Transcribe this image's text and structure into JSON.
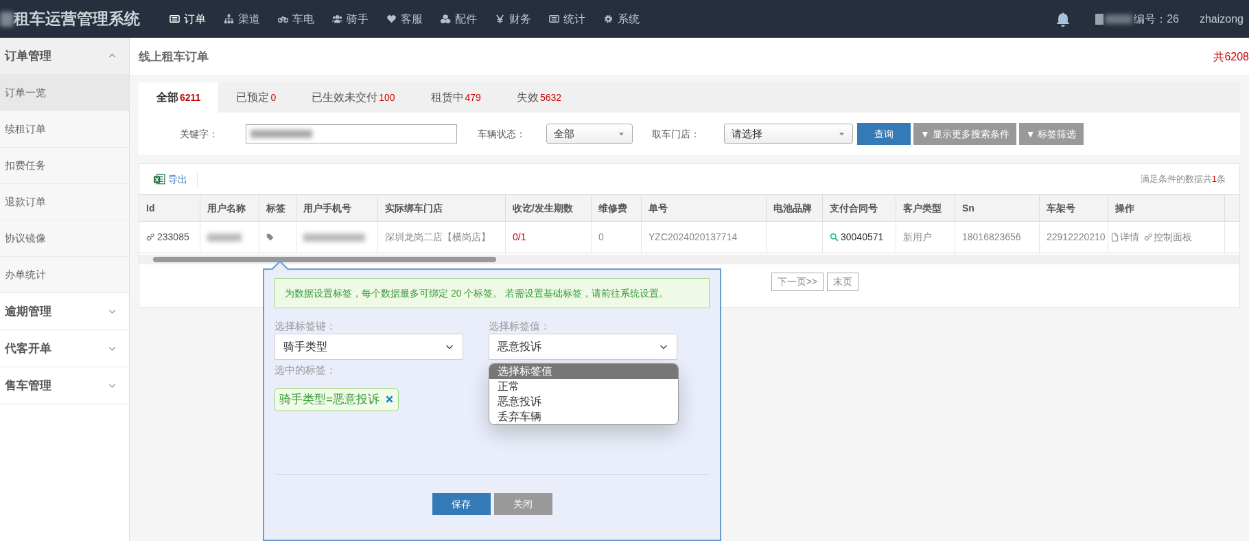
{
  "app_title": "租车运营管理系统",
  "nav": [
    {
      "label": "订单",
      "selected": true
    },
    {
      "label": "渠道",
      "selected": false
    },
    {
      "label": "车电",
      "selected": false
    },
    {
      "label": "骑手",
      "selected": false
    },
    {
      "label": "客服",
      "selected": false
    },
    {
      "label": "配件",
      "selected": false
    },
    {
      "label": "财务",
      "selected": false
    },
    {
      "label": "统计",
      "selected": false
    },
    {
      "label": "系统",
      "selected": false
    }
  ],
  "user": {
    "account": "编号：26",
    "name": "zhaizong"
  },
  "sidebar": [
    {
      "label": "订单管理",
      "expanded": true,
      "children": [
        {
          "label": "订单一览",
          "selected": true
        },
        {
          "label": "续租订单",
          "selected": false
        },
        {
          "label": "扣费任务",
          "selected": false
        },
        {
          "label": "退款订单",
          "selected": false
        },
        {
          "label": "协议镜像",
          "selected": false
        },
        {
          "label": "办单统计",
          "selected": false
        }
      ]
    },
    {
      "label": "逾期管理",
      "expanded": false
    },
    {
      "label": "代客开单",
      "expanded": false
    },
    {
      "label": "售车管理",
      "expanded": false
    }
  ],
  "page_title": "线上租车订单",
  "total": "共6208",
  "tabs": [
    {
      "label": "全部",
      "count": "6211",
      "selected": true
    },
    {
      "label": "已预定",
      "count": "0",
      "selected": false
    },
    {
      "label": "已生效未交付",
      "count": "100",
      "selected": false
    },
    {
      "label": "租赁中",
      "count": "479",
      "selected": false
    },
    {
      "label": "失效",
      "count": "5632",
      "selected": false
    }
  ],
  "filters": {
    "keyword_label": "关键字：",
    "vehicle_status_label": "车辆状态：",
    "vehicle_status": "全部",
    "store_label": "取车门店：",
    "store": "请选择",
    "search_button": "查询",
    "more_button": "▼ 显示更多搜索条件",
    "tag_button": "▼ 标签筛选"
  },
  "export": "导出",
  "result_text": "满足条件的数据共**1**条",
  "table": {
    "columns": [
      "Id",
      "用户名称",
      "标签",
      "用户手机号",
      "实际绑车门店",
      "收讫/发生期数",
      "维修费",
      "单号",
      "电池品牌",
      "支付合同号",
      "客户类型",
      "Sn",
      "车架号",
      "操作"
    ],
    "rows": [
      {
        "id": "233085",
        "store": "深圳龙岗二店【横岗店】",
        "periods": "0/1",
        "repair_fee": "0",
        "order_no": "YZC2024020137714",
        "battery_brand": "",
        "contract": "30040571",
        "customer_type": "新用户",
        "sn": "18016823656",
        "frame_no": "22912220210",
        "detail": "详情",
        "control": "控制面板"
      }
    ]
  },
  "pagination": [
    "下一页>>",
    "末页"
  ],
  "tag_dialog": {
    "notice": "为数据设置标签，每个数据最多可绑定 20 个标签。 若需设置基础标签，请前往系统设置。",
    "key_label": "选择标签键：",
    "key_value": "骑手类型",
    "value_label": "选择标签值：",
    "value_value": "恶意投诉",
    "options": [
      {
        "label": "选择标签值",
        "highlighted": true
      },
      {
        "label": "正常",
        "highlighted": false
      },
      {
        "label": "恶意投诉",
        "highlighted": false
      },
      {
        "label": "丢弃车辆",
        "highlighted": false
      }
    ],
    "selected_label": "选中的标签：",
    "selected_tags": [
      "骑手类型=恶意投诉"
    ],
    "save": "保存",
    "close": "关闭"
  }
}
